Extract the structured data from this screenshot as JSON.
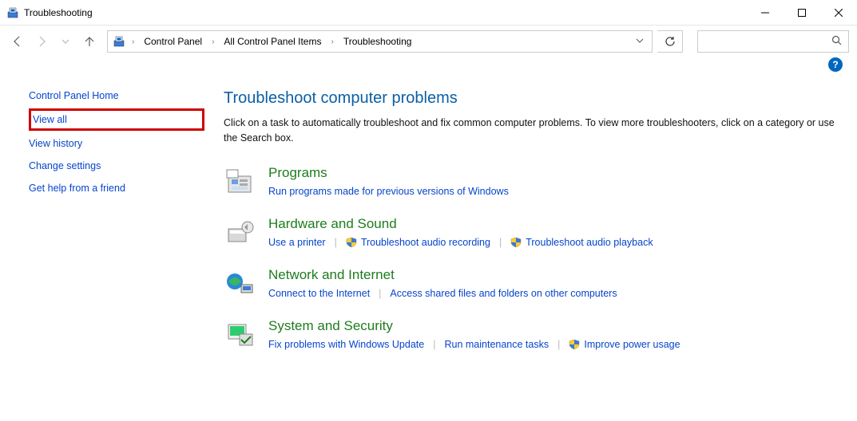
{
  "window": {
    "title": "Troubleshooting"
  },
  "breadcrumb": {
    "items": [
      "Control Panel",
      "All Control Panel Items",
      "Troubleshooting"
    ]
  },
  "search": {
    "placeholder": ""
  },
  "sidebar": {
    "home": "Control Panel Home",
    "view_all": "View all",
    "view_history": "View history",
    "change_settings": "Change settings",
    "get_help": "Get help from a friend"
  },
  "main": {
    "heading": "Troubleshoot computer problems",
    "description": "Click on a task to automatically troubleshoot and fix common computer problems. To view more troubleshooters, click on a category or use the Search box.",
    "categories": {
      "programs": {
        "title": "Programs",
        "links": {
          "compat": "Run programs made for previous versions of Windows"
        }
      },
      "hardware": {
        "title": "Hardware and Sound",
        "links": {
          "printer": "Use a printer",
          "audio_rec": "Troubleshoot audio recording",
          "audio_play": "Troubleshoot audio playback"
        }
      },
      "network": {
        "title": "Network and Internet",
        "links": {
          "connect": "Connect to the Internet",
          "shared": "Access shared files and folders on other computers"
        }
      },
      "system": {
        "title": "System and Security",
        "links": {
          "winupdate": "Fix problems with Windows Update",
          "maint": "Run maintenance tasks",
          "power": "Improve power usage"
        }
      }
    }
  },
  "help": {
    "glyph": "?"
  }
}
